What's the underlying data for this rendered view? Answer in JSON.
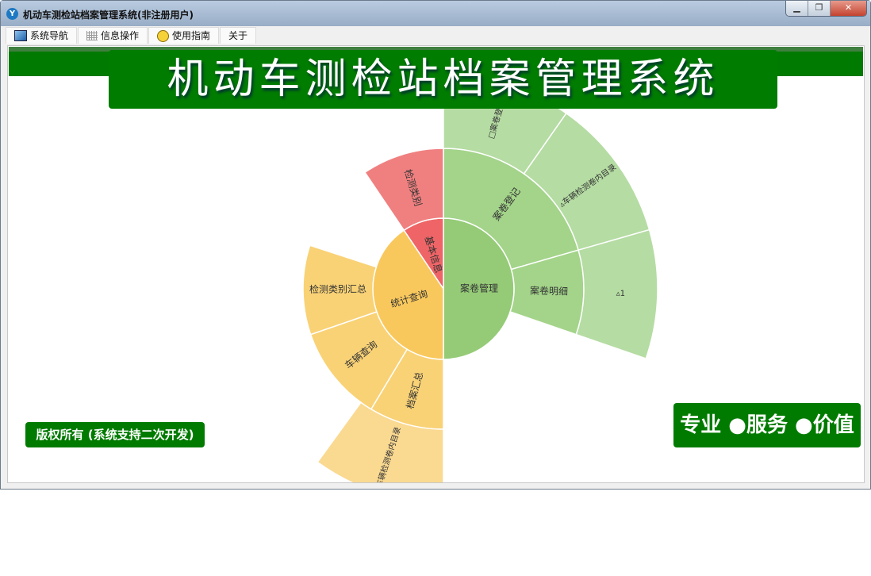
{
  "window": {
    "title": "机动车测检站档案管理系统(非注册用户)",
    "controls": [
      "minimize",
      "restore",
      "close"
    ]
  },
  "menu": [
    {
      "label": "系统导航",
      "icon": "monitor-icon"
    },
    {
      "label": "信息操作",
      "icon": "grid-icon"
    },
    {
      "label": "使用指南",
      "icon": "help-icon"
    },
    {
      "label": "关于",
      "icon": ""
    }
  ],
  "banner": {
    "title": "机动车测检站档案管理系统"
  },
  "footer": {
    "copyright": "版权所有 (系统支持二次开发)",
    "slogan": "专业 ●服务 ●价值"
  },
  "colors": {
    "brand_green": "#007b00"
  },
  "chart_data": {
    "type": "sunburst",
    "nodes": [
      {
        "name": "案卷管理",
        "value": 180,
        "color": "#95cb77",
        "children": [
          {
            "name": "案卷登记",
            "value": 74,
            "color": "#a3d48a",
            "children": [
              {
                "name": "□案卷登记",
                "value": 35,
                "color": "#b5dca3"
              },
              {
                "name": "▵车辆检测卷内目录",
                "value": 39,
                "color": "#b5dca3"
              }
            ]
          },
          {
            "name": "案卷明细",
            "value": 35,
            "color": "#a3d48a",
            "children": [
              {
                "name": "▵1",
                "value": 35,
                "color": "#b5dca3"
              }
            ]
          }
        ]
      },
      {
        "name": "统计查询",
        "value": 146,
        "color": "#f9c85c",
        "children": [
          {
            "name": "档案汇总",
            "value": 31,
            "color": "#f9d276",
            "children": [
              {
                "name": "车辆检测卷内目录",
                "value": 36,
                "color": "#fad991"
              }
            ]
          },
          {
            "name": "车辆查询",
            "value": 40,
            "color": "#f9d276"
          },
          {
            "name": "检测类别汇总",
            "value": 37,
            "color": "#f9d276"
          }
        ]
      },
      {
        "name": "基本信息",
        "value": 34,
        "color": "#ef6567",
        "children": [
          {
            "name": "检测类别",
            "value": 34,
            "color": "#f08080"
          }
        ]
      }
    ]
  }
}
